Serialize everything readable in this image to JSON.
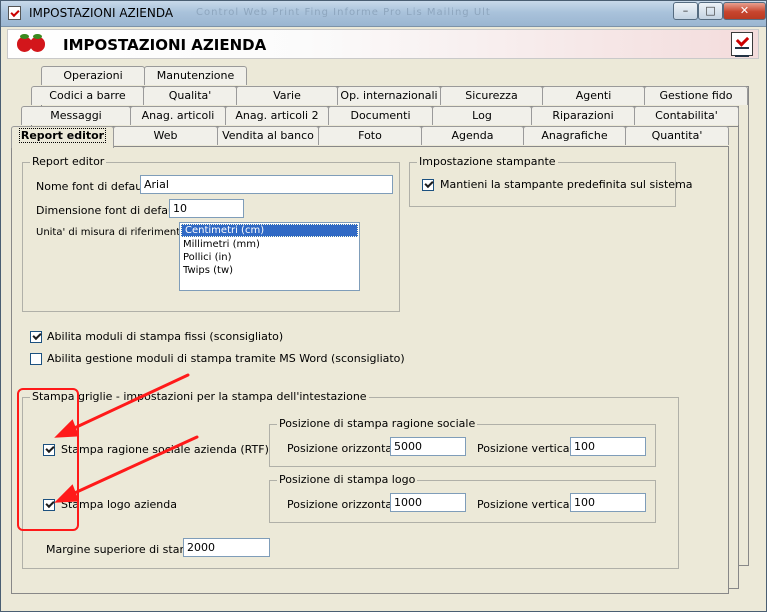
{
  "window": {
    "title": "IMPOSTAZIONI AZIENDA",
    "ghost_text": "Control  Web  Print  Fing  Informe  Pro  Lis  Mailing  Ult",
    "min": "–",
    "max": "□",
    "close": "✕"
  },
  "banner": {
    "title": "IMPOSTAZIONI AZIENDA"
  },
  "tabs": {
    "row1": [
      "Operazioni",
      "Manutenzione"
    ],
    "row2": [
      "Codici a barre",
      "Qualita'",
      "Varie",
      "Op. internazionali",
      "Sicurezza",
      "Agenti",
      "Gestione fido"
    ],
    "row3": [
      "Messaggi",
      "Anag. articoli",
      "Anag. articoli 2",
      "Documenti",
      "Log",
      "Riparazioni",
      "Contabilita'"
    ],
    "row4": [
      "Report editor",
      "Web",
      "Vendita al banco",
      "Foto",
      "Agenda",
      "Anagrafiche",
      "Quantita'"
    ]
  },
  "report_editor": {
    "group_title": "Report editor",
    "font_label": "Nome font di default",
    "font_value": "Arial",
    "size_label": "Dimensione font di default",
    "size_value": "10",
    "unit_label": "Unita' di misura di riferimento",
    "units": [
      "Centimetri (cm)",
      "Millimetri (mm)",
      "Pollici (in)",
      "Twips (tw)"
    ]
  },
  "printer": {
    "group_title": "Impostazione stampante",
    "keep_default": "Mantieni la stampante predefinita sul sistema"
  },
  "options": {
    "fixed_modules": "Abilita moduli di stampa fissi (sconsigliato)",
    "word_modules": "Abilita gestione moduli di stampa tramite MS Word (sconsigliato)"
  },
  "grid": {
    "group_title": "Stampa griglie - impostazioni per la stampa dell'intestazione",
    "company_name": "Stampa ragione sociale azienda (RTF)",
    "logo": "Stampa logo azienda",
    "name_pos_title": "Posizione di stampa ragione sociale",
    "logo_pos_title": "Posizione di stampa logo",
    "horiz_label": "Posizione orizzontale",
    "vert_label": "Posizione verticale",
    "name_h": "5000",
    "name_v": "100",
    "logo_h": "1000",
    "logo_v": "100",
    "margin_label": "Margine superiore di stampa",
    "margin_value": "2000"
  },
  "annotation_color": "#ff1a1a"
}
